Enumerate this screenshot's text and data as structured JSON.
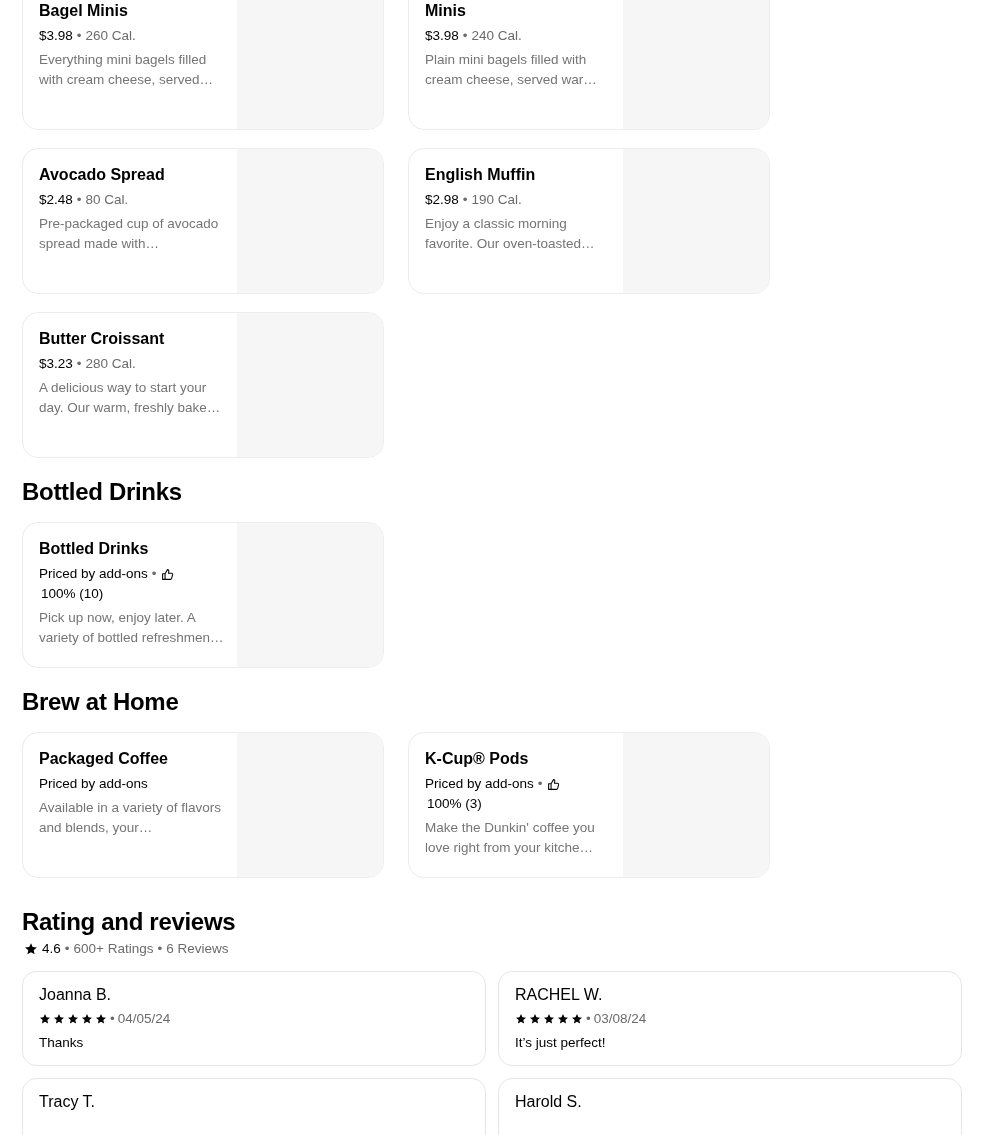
{
  "separator": "•",
  "sections": [
    {
      "items": [
        {
          "name": "Bagel Minis",
          "price": "$3.98",
          "calories": "260 Cal.",
          "description": "Everything mini bagels filled with cream cheese, served…"
        },
        {
          "name": "Minis",
          "price": "$3.98",
          "calories": "240 Cal.",
          "description": "Plain mini bagels filled with cream cheese, served war…"
        },
        {
          "name": "Avocado Spread",
          "price": "$2.48",
          "calories": "80 Cal.",
          "description": "Pre-packaged cup of avocado spread made with…"
        },
        {
          "name": "English Muffin",
          "price": "$2.98",
          "calories": "190 Cal.",
          "description": "Enjoy a classic morning favorite. Our oven-toasted…"
        },
        {
          "name": "Butter Croissant",
          "price": "$3.23",
          "calories": "280 Cal.",
          "description": "A delicious way to start your day. Our warm, freshly bake…"
        }
      ]
    },
    {
      "title": "Bottled Drinks",
      "items": [
        {
          "name": "Bottled Drinks",
          "price": "Priced by add-ons",
          "thumbs_rating": "100% (10)",
          "description": "Pick up now, enjoy later. A variety of bottled refreshmen…"
        }
      ]
    },
    {
      "title": "Brew at Home",
      "items": [
        {
          "name": "Packaged Coffee",
          "price": "Priced by add-ons",
          "description": "Available in a variety of flavors and blends, your…"
        },
        {
          "name": "K-Cup® Pods",
          "price": "Priced by add-ons",
          "thumbs_rating": "100% (3)",
          "description": "Make the Dunkin' coffee you love right from your kitche…"
        }
      ]
    }
  ],
  "reviews_section": {
    "title": "Rating and reviews",
    "rating": "4.6",
    "ratings_count": "600+ Ratings",
    "reviews_count": "6 Reviews",
    "reviews": [
      {
        "name": "Joanna B.",
        "stars": 5,
        "date": "04/05/24",
        "text": "Thanks"
      },
      {
        "name": "RACHEL W.",
        "stars": 5,
        "date": "03/08/24",
        "text": "It’s just perfect!"
      },
      {
        "name": "Tracy T."
      },
      {
        "name": "Harold S."
      }
    ]
  }
}
